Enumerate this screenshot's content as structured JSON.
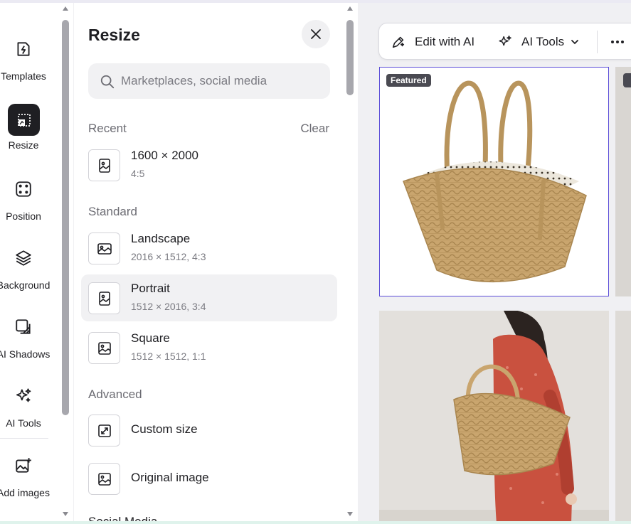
{
  "nav": {
    "items": [
      {
        "label": "Templates",
        "icon": "templates-icon"
      },
      {
        "label": "Resize",
        "icon": "resize-icon",
        "active": true
      },
      {
        "label": "Position",
        "icon": "position-icon"
      },
      {
        "label": "Background",
        "icon": "background-icon"
      },
      {
        "label": "AI Shadows",
        "icon": "ai-shadows-icon"
      },
      {
        "label": "AI Tools",
        "icon": "ai-tools-icon"
      },
      {
        "label": "Add images",
        "icon": "add-images-icon"
      }
    ]
  },
  "panel": {
    "title": "Resize",
    "search_placeholder": "Marketplaces, social media",
    "recent": {
      "heading": "Recent",
      "clear_label": "Clear",
      "items": [
        {
          "title": "1600 × 2000",
          "subtitle": "4:5"
        }
      ]
    },
    "standard": {
      "heading": "Standard",
      "items": [
        {
          "title": "Landscape",
          "subtitle": "2016 × 1512, 4:3"
        },
        {
          "title": "Portrait",
          "subtitle": "1512 × 2016, 3:4",
          "selected": true
        },
        {
          "title": "Square",
          "subtitle": "1512 × 1512, 1:1"
        }
      ]
    },
    "advanced": {
      "heading": "Advanced",
      "items": [
        {
          "title": "Custom size"
        },
        {
          "title": "Original image"
        }
      ]
    },
    "next_heading_partial": "Social Media"
  },
  "toolbar": {
    "edit_label": "Edit with AI",
    "ai_tools_label": "AI Tools"
  },
  "gallery": {
    "featured_badge": "Featured",
    "cards": [
      {
        "name": "woven-basket-bag-product",
        "featured": true
      },
      {
        "name": "model-holding-basket-bag"
      }
    ]
  },
  "colors": {
    "accent": "#5b4dd8",
    "active_nav_bg": "#1f1f23",
    "basket": "#c9a56e",
    "dress": "#c9513f"
  }
}
